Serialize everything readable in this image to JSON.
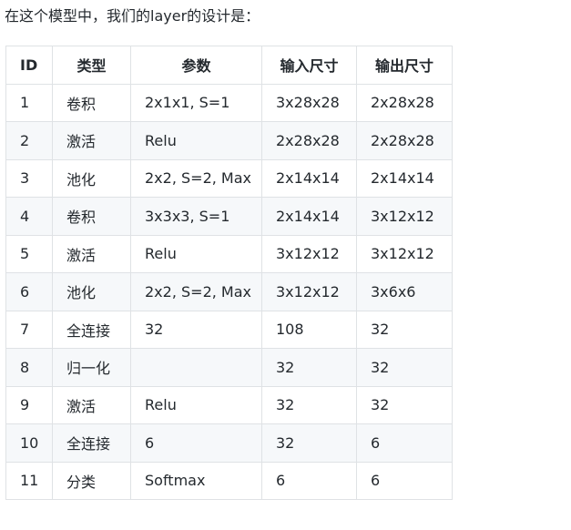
{
  "intro": "在这个模型中，我们的layer的设计是：",
  "table": {
    "headers": [
      "ID",
      "类型",
      "参数",
      "输入尺寸",
      "输出尺寸"
    ],
    "rows": [
      [
        "1",
        "卷积",
        "2x1x1, S=1",
        "3x28x28",
        "2x28x28"
      ],
      [
        "2",
        "激活",
        "Relu",
        "2x28x28",
        "2x28x28"
      ],
      [
        "3",
        "池化",
        "2x2, S=2, Max",
        "2x14x14",
        "2x14x14"
      ],
      [
        "4",
        "卷积",
        "3x3x3, S=1",
        "2x14x14",
        "3x12x12"
      ],
      [
        "5",
        "激活",
        "Relu",
        "3x12x12",
        "3x12x12"
      ],
      [
        "6",
        "池化",
        "2x2, S=2, Max",
        "3x12x12",
        "3x6x6"
      ],
      [
        "7",
        "全连接",
        "32",
        "108",
        "32"
      ],
      [
        "8",
        "归一化",
        "",
        "32",
        "32"
      ],
      [
        "9",
        "激活",
        "Relu",
        "32",
        "32"
      ],
      [
        "10",
        "全连接",
        "6",
        "32",
        "6"
      ],
      [
        "11",
        "分类",
        "Softmax",
        "6",
        "6"
      ]
    ]
  }
}
